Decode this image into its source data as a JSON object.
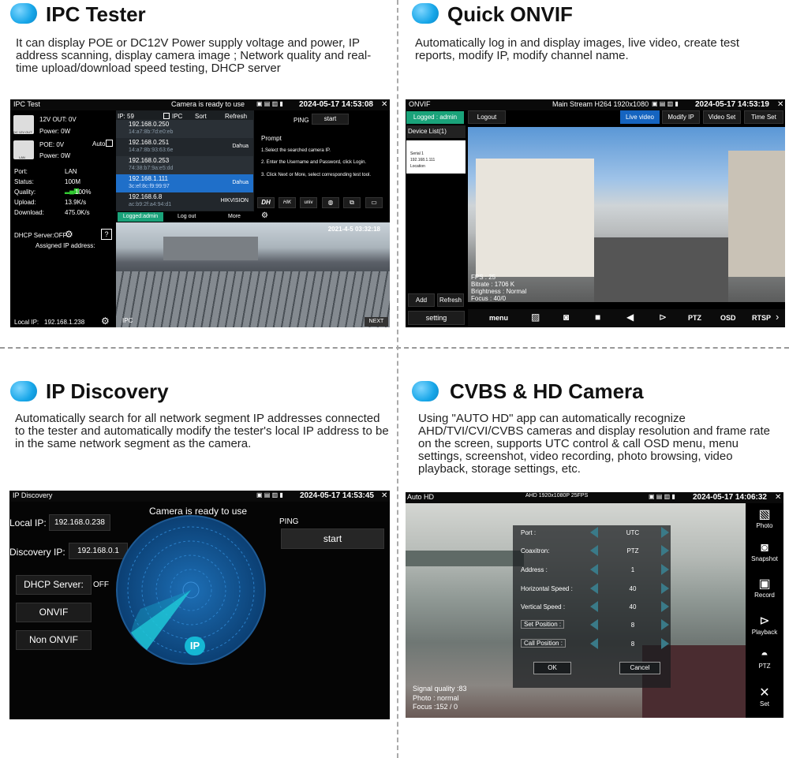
{
  "sections": {
    "ipc": {
      "title": "IPC Tester",
      "desc": "It can display POE or DC12V Power supply voltage and power, IP address scanning, display camera image ; Network quality and real-time upload/download speed testing, DHCP server"
    },
    "onvif": {
      "title": "Quick ONVIF",
      "desc": "Automatically log in and display images, live video, create test reports, modify IP, modify channel name."
    },
    "discovery": {
      "title": "IP Discovery",
      "desc": "Automatically search for all network segment IP addresses connected to the tester and automatically modify the tester's local IP address to be in the same network segment as the camera."
    },
    "cvbs": {
      "title": "CVBS & HD Camera",
      "desc": "Using \"AUTO HD\" app can automatically recognize AHD/TVI/CVI/CVBS cameras and display resolution and frame rate on the screen, supports UTC control & call OSD menu, menu settings, screenshot, video recording, photo browsing, video playback, storage settings, etc."
    }
  },
  "ipc_screen": {
    "app_title": "IPC Test",
    "status_msg": "Camera is ready to use",
    "datetime": "2024-05-17 14:53:08",
    "dc_label": "DC 12V OUT",
    "lan_label": "LAN",
    "out12v": "12V OUT: 0V",
    "power1": "Power: 0W",
    "poe": "POE: 0V",
    "auto": "Auto",
    "power2": "Power: 0W",
    "port_l": "Port:",
    "port_v": "LAN",
    "status_l": "Status:",
    "status_v": "100M",
    "quality_l": "Quality:",
    "quality_v": "100%",
    "upload_l": "Upload:",
    "upload_v": "13.9K/s",
    "download_l": "Download:",
    "download_v": "475.0K/s",
    "dhcp": "DHCP Server:OFF",
    "assigned": "Assigned IP address:",
    "local_ip_l": "Local IP:",
    "local_ip_v": "192.168.1.238",
    "ip_count": "IP: 59",
    "ipc_chk": "IPC",
    "sort": "Sort",
    "refresh": "Refresh",
    "ip_list": [
      {
        "ip": "192.168.0.250",
        "mac": "14:a7:8b:7d:e0:eb",
        "vendor": ""
      },
      {
        "ip": "192.168.0.251",
        "mac": "14:a7:8b:93:63:6e",
        "vendor": "Dahua"
      },
      {
        "ip": "192.168.0.253",
        "mac": "74:38:b7:9a:e5:dd",
        "vendor": ""
      },
      {
        "ip": "192.168.1.111",
        "mac": "3c:ef:8c:f9:99:97",
        "vendor": "Dahua"
      },
      {
        "ip": "192.168.6.8",
        "mac": "ac:b9:2f:a4:94:d1",
        "vendor": "HIKVISION"
      }
    ],
    "dahua_top": "Dahua",
    "ping": "PING",
    "start": "start",
    "prompt_title": "Prompt",
    "prompt_lines": [
      "1.Select the searched camera IP.",
      "2. Enter the Username and Password, click Login.",
      "3. Click Next or More, select corresponding test tool."
    ],
    "brands": [
      "DH",
      "HIK",
      "univ"
    ],
    "logged": "Logged:admin",
    "logout": "Log out",
    "more": "More",
    "video_time": "2021-4-5 03:32:18",
    "ipc_tag": "IPC",
    "next": "NEXT"
  },
  "onvif_screen": {
    "app_title": "ONVIF",
    "stream": "Main Stream H264 1920x1080",
    "datetime": "2024-05-17 14:53:19",
    "logged": "Logged : admin",
    "logout": "Logout",
    "tabs": [
      "Live video",
      "Modify IP",
      "Video Set",
      "Time Set"
    ],
    "device_list": "Device List(1)",
    "device_lines": [
      "Serial 1",
      "192.168.1.111",
      "Location"
    ],
    "add": "Add",
    "refresh": "Refresh",
    "setting": "setting",
    "overlay": [
      "FPS : 25",
      "Bitrate : 1706 K",
      "Brightness : Normal",
      "Focus : 40/0"
    ],
    "toolbar": [
      "menu",
      "PTZ",
      "OSD",
      "RTSP"
    ]
  },
  "disc_screen": {
    "app_title": "IP Discovery",
    "datetime": "2024-05-17 14:53:45",
    "ready": "Camera is ready to use",
    "local_ip_l": "Local IP:",
    "local_ip_v": "192.168.0.238",
    "disc_ip_l": "Discovery IP:",
    "disc_ip_v": "192.168.0.1",
    "dhcp": "DHCP Server:",
    "dhcp_state": "OFF",
    "onvif": "ONVIF",
    "nononvif": "Non ONVIF",
    "ping": "PING",
    "start": "start",
    "radar_label": "IP"
  },
  "hd_screen": {
    "app_title": "Auto HD",
    "format": "AHD 1920x1080P 25FPS",
    "datetime": "2024-05-17 14:06:32",
    "rows": [
      {
        "label": "Port :",
        "value": "UTC"
      },
      {
        "label": "Coaxitron:",
        "value": "PTZ"
      },
      {
        "label": "Address :",
        "value": "1"
      },
      {
        "label": "Horizontal Speed :",
        "value": "40"
      },
      {
        "label": "Vertical Speed :",
        "value": "40"
      },
      {
        "label": "Set Position :",
        "value": "8"
      },
      {
        "label": "Call Position :",
        "value": "8"
      }
    ],
    "ok": "OK",
    "cancel": "Cancel",
    "overlay": [
      "Signal quality :83",
      "Photo : normal",
      "Focus :152 / 0"
    ],
    "side": [
      "Photo",
      "Snapshot",
      "Record",
      "Playback",
      "PTZ",
      "Set"
    ]
  },
  "colors": {
    "accent": "#17a6e8",
    "tab_blue": "#1564c0",
    "logged_green": "#1aa37a"
  }
}
